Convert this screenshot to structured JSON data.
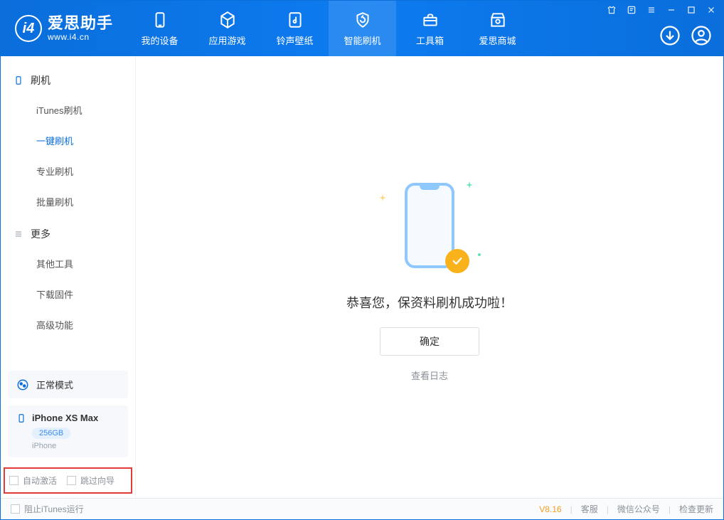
{
  "app": {
    "name": "爱思助手",
    "url": "www.i4.cn"
  },
  "nav": {
    "items": [
      {
        "label": "我的设备"
      },
      {
        "label": "应用游戏"
      },
      {
        "label": "铃声壁纸"
      },
      {
        "label": "智能刷机"
      },
      {
        "label": "工具箱"
      },
      {
        "label": "爱思商城"
      }
    ]
  },
  "sidebar": {
    "group_flash": "刷机",
    "group_more": "更多",
    "items_flash": [
      {
        "label": "iTunes刷机"
      },
      {
        "label": "一键刷机"
      },
      {
        "label": "专业刷机"
      },
      {
        "label": "批量刷机"
      }
    ],
    "items_more": [
      {
        "label": "其他工具"
      },
      {
        "label": "下载固件"
      },
      {
        "label": "高级功能"
      }
    ],
    "mode": "正常模式",
    "device": {
      "name": "iPhone XS Max",
      "capacity": "256GB",
      "type": "iPhone"
    },
    "chk_auto_activate": "自动激活",
    "chk_skip_guide": "跳过向导"
  },
  "content": {
    "success_msg": "恭喜您，保资料刷机成功啦！",
    "ok_btn": "确定",
    "log_link": "查看日志"
  },
  "status": {
    "block_itunes": "阻止iTunes运行",
    "version": "V8.16",
    "support": "客服",
    "wechat": "微信公众号",
    "update": "检查更新"
  }
}
